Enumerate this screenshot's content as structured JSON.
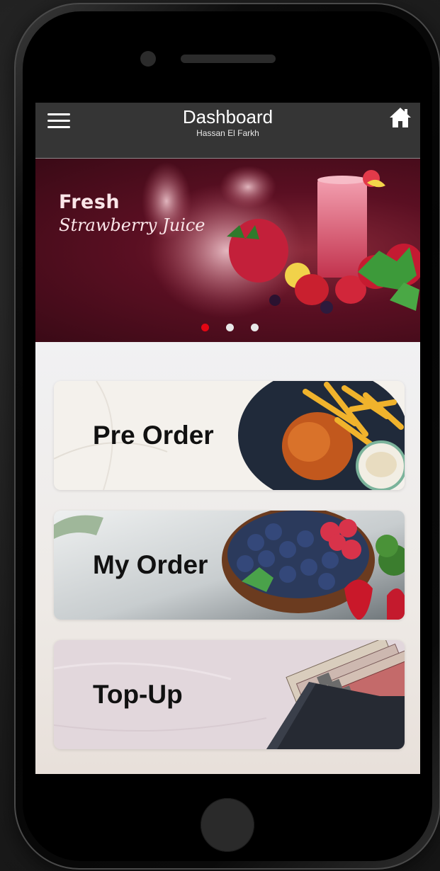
{
  "header": {
    "title": "Dashboard",
    "subtitle": "Hassan El Farkh",
    "menu_icon": "hamburger-menu-icon",
    "home_icon": "home-icon"
  },
  "banner": {
    "line1": "Fresh",
    "line2": "Strawberry Juice",
    "slide_count": 3,
    "active_slide": 1
  },
  "menu_cards": [
    {
      "label": "Pre Order"
    },
    {
      "label": "My Order"
    },
    {
      "label": "Top-Up"
    }
  ],
  "colors": {
    "header_bg": "#353535",
    "active_dot": "#e30613",
    "inactive_dot": "#e8e8e8",
    "card_text": "#111111"
  }
}
